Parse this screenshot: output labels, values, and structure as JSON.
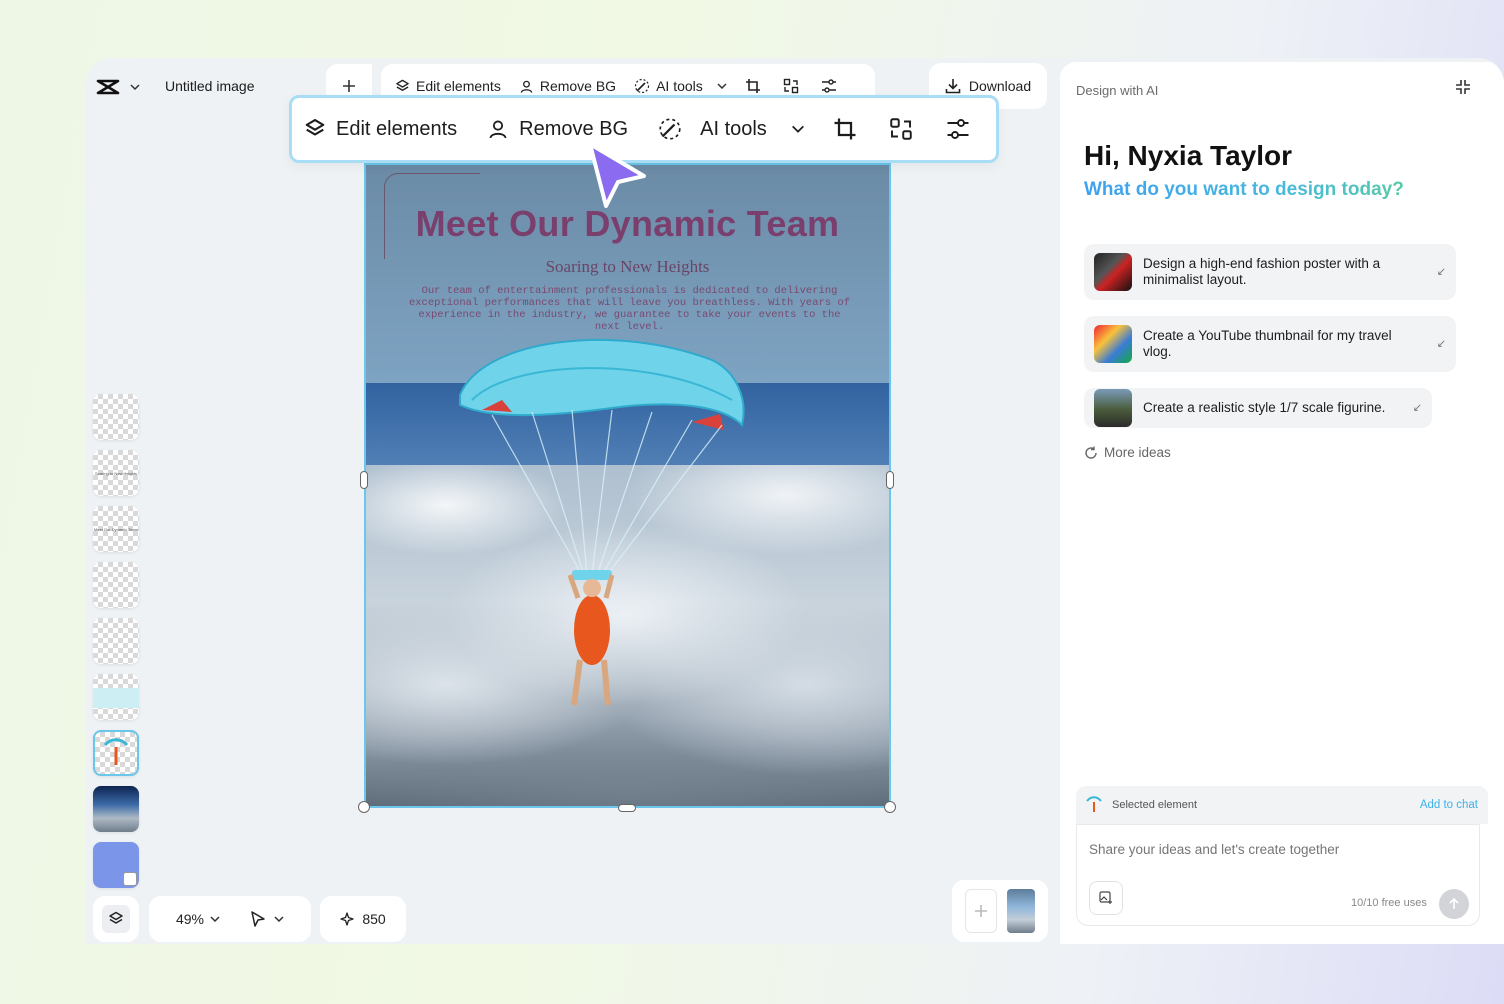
{
  "header": {
    "doc_title": "Untitled image",
    "download_label": "Download"
  },
  "toolbar": {
    "edit_elements": "Edit elements",
    "remove_bg": "Remove BG",
    "ai_tools": "AI tools"
  },
  "poster": {
    "title": "Meet Our Dynamic Team",
    "subtitle": "Soaring to New Heights",
    "body": "Our team of entertainment professionals is dedicated to delivering exceptional performances that will leave you breathless. With years of experience in the industry, we guarantee to take your events to the next level."
  },
  "layers": [
    {
      "label": ""
    },
    {
      "label": "Soaring to New Heights"
    },
    {
      "label": "Meet Our Dynamic Team"
    },
    {
      "label": ""
    },
    {
      "label": ""
    },
    {
      "label": ""
    },
    {
      "label": ""
    },
    {
      "label": ""
    },
    {
      "label": ""
    }
  ],
  "bottom": {
    "zoom": "49%",
    "credits": "850"
  },
  "panel": {
    "header": "Design with AI",
    "greeting": "Hi, Nyxia Taylor",
    "question": "What do you want to design today?",
    "suggestions": [
      "Design a high-end fashion poster with a minimalist layout.",
      "Create a YouTube thumbnail for my travel vlog.",
      "Create a realistic style 1/7 scale figurine."
    ],
    "more_ideas": "More ideas",
    "selected_element": "Selected element",
    "add_to_chat": "Add to chat",
    "chat_placeholder": "Share your ideas and let's create together",
    "free_uses": "10/10 free uses"
  },
  "colors": {
    "accent": "#6ac6ea",
    "cursor": "#8b6cf0",
    "poster_title": "#7a3f6c"
  }
}
